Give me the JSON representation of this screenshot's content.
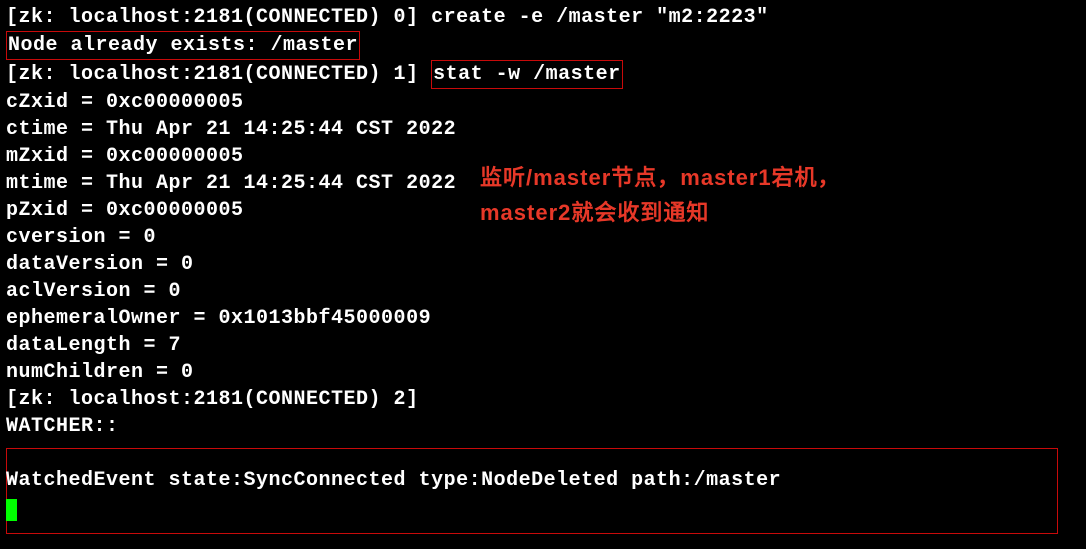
{
  "terminal": {
    "line1_prompt": "[zk: localhost:2181(CONNECTED) 0] ",
    "line1_cmd": "create -e /master \"m2:2223\"",
    "line2_msg": "Node already exists: /master",
    "line3_prompt": "[zk: localhost:2181(CONNECTED) 1] ",
    "line3_cmd": "stat -w /master",
    "stat": {
      "cZxid": "cZxid = 0xc00000005",
      "ctime": "ctime = Thu Apr 21 14:25:44 CST 2022",
      "mZxid": "mZxid = 0xc00000005",
      "mtime": "mtime = Thu Apr 21 14:25:44 CST 2022",
      "pZxid": "pZxid = 0xc00000005",
      "cversion": "cversion = 0",
      "dataVersion": "dataVersion = 0",
      "aclVersion": "aclVersion = 0",
      "ephemeralOwner": "ephemeralOwner = 0x1013bbf45000009",
      "dataLength": "dataLength = 7",
      "numChildren": "numChildren = 0"
    },
    "line15_prompt": "[zk: localhost:2181(CONNECTED) 2]",
    "watcher_header": "WATCHER::",
    "watcher_blank": " ",
    "watcher_event": "WatchedEvent state:SyncConnected type:NodeDeleted path:/master"
  },
  "annotation": {
    "line1": "监听/master节点，master1宕机，",
    "line2": "master2就会收到通知"
  }
}
